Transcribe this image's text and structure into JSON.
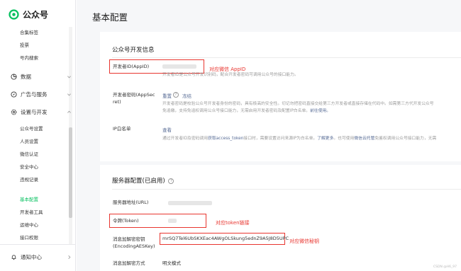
{
  "app": {
    "name": "公众号",
    "brand_color": "#07c160"
  },
  "sidebar": {
    "top_items": [
      {
        "label": "合集标签"
      },
      {
        "label": "投票"
      },
      {
        "label": "号内搜索"
      }
    ],
    "groups": {
      "data": {
        "label": "数据",
        "icon": "chart-icon"
      },
      "ads": {
        "label": "广告与服务",
        "icon": "compass-icon"
      },
      "settings": {
        "label": "设置与开发",
        "icon": "gear-icon"
      }
    },
    "settings_items": [
      {
        "label": "公众号设置"
      },
      {
        "label": "人员设置"
      },
      {
        "label": "微信认证"
      },
      {
        "label": "安全中心"
      },
      {
        "label": "违规记录"
      }
    ],
    "dev_items": [
      {
        "label": "基本配置",
        "active": true
      },
      {
        "label": "开发者工具"
      },
      {
        "label": "运维中心"
      },
      {
        "label": "接口权限"
      }
    ],
    "bottom": {
      "label": "通知中心",
      "icon": "bell-icon"
    }
  },
  "page": {
    "title": "基本配置",
    "dev_info": {
      "title": "公众号开发信息",
      "appid": {
        "label": "开发者ID(AppID)",
        "desc": "开发者ID是公众号开发识别码，配合开发者密码可调用公众号的接口能力。",
        "annotation": "对应微信 AppID"
      },
      "secret": {
        "label_line1": "开发者密码(AppSec",
        "label_line2": "ret)",
        "reset_link": "重置",
        "help_icon": "question-icon",
        "freeze_link": "冻结",
        "desc_line1": "开发者密码是校验公众号开发者身份的密码，具有极高的安全性。切记勿把密码直接交给第三方开发者或直接存储在代码中。如需第三方代开发公众号",
        "desc_line2": "免追缴，支持免追权调用公众号接口能力，无需启用开发者密码及配置IP白名单。",
        "desc_link": "前往使用。"
      },
      "ip": {
        "label": "IP白名单",
        "view_link": "查看",
        "desc_pre": "通过开发者ID及密码调用",
        "desc_api": "获取access_token",
        "desc_mid": "接口时，需要设置访问来源IP为白名单。",
        "desc_more": "了解更多",
        "desc_post": "。也可使用",
        "desc_cloud": "微信云托管",
        "desc_end": "免鉴权调用公众号接口能力，无需"
      }
    },
    "server_config": {
      "title": "服务器配置(已启用)",
      "help_icon": "question-icon",
      "url": {
        "label": "服务器地址(URL)"
      },
      "token": {
        "label": "令牌(Token)",
        "annotation": "对应token链接"
      },
      "aes": {
        "label_line1": "消息加解密密钥",
        "label_line2": "(EncodingAESKey)",
        "value": "mrSQ7Tel6UbSKXEac4AWgOLSkung5ednZ9A5J8D5UPC",
        "annotation": "对应微信秘钥"
      },
      "mode": {
        "label": "消息加解密方式",
        "value": "明文模式"
      }
    },
    "watermark": "CSDN @H6_97"
  }
}
